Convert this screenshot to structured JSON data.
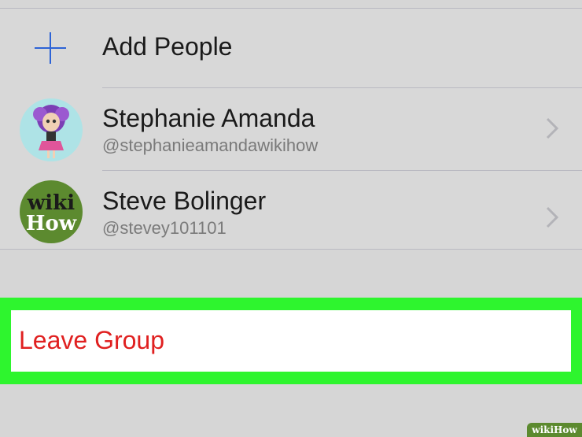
{
  "add_people": {
    "label": "Add People",
    "icon": "plus-icon"
  },
  "members": [
    {
      "name": "Stephanie Amanda",
      "handle": "@stephanieamandawikihow",
      "avatar": "doll-avatar"
    },
    {
      "name": "Steve Bolinger",
      "handle": "@stevey101101",
      "avatar": "wikihow-logo-avatar",
      "avatar_text": [
        "wiki",
        "How"
      ]
    }
  ],
  "leave_group": {
    "label": "Leave Group"
  },
  "watermark": {
    "text": "wikiHow"
  },
  "colors": {
    "accent": "#2d63d6",
    "destructive": "#e02020",
    "highlight": "#2ef52e",
    "background": "#d6d6d6"
  }
}
